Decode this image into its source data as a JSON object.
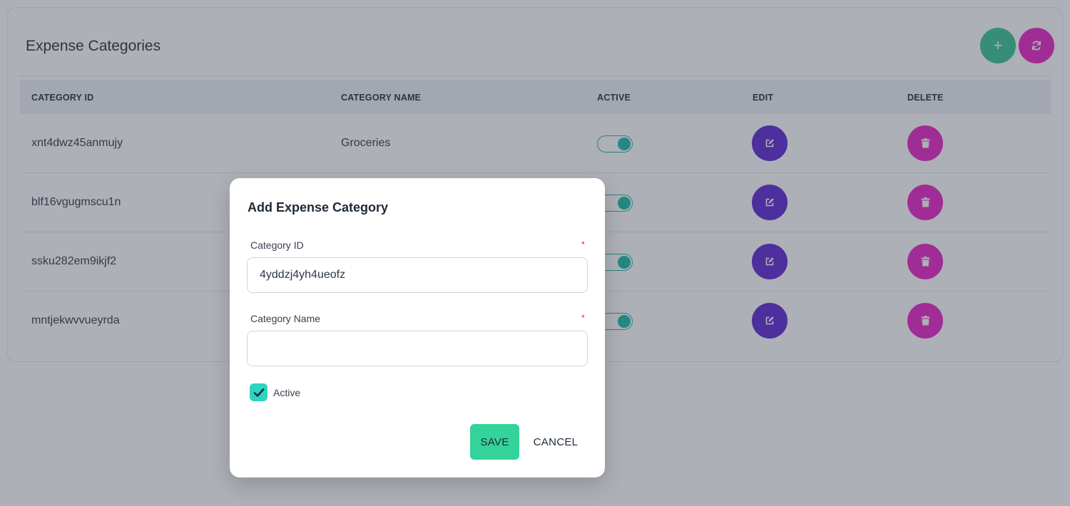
{
  "page": {
    "title": "Expense Categories"
  },
  "toolbar": {
    "add_icon": "plus-icon",
    "refresh_icon": "refresh-icon"
  },
  "table": {
    "columns": [
      "CATEGORY ID",
      "CATEGORY NAME",
      "ACTIVE",
      "EDIT",
      "DELETE"
    ],
    "rows": [
      {
        "id": "xnt4dwz45anmujy",
        "name": "Groceries",
        "active": true
      },
      {
        "id": "blf16vgugmscu1n",
        "name": "",
        "active": true
      },
      {
        "id": "ssku282em9ikjf2",
        "name": "",
        "active": true
      },
      {
        "id": "mntjekwvvueyrda",
        "name": "",
        "active": true
      }
    ]
  },
  "modal": {
    "title": "Add Expense Category",
    "category_id_label": "Category ID",
    "category_id_required": "*",
    "category_id_value": "4yddzj4yh4ueofz",
    "category_name_label": "Category Name",
    "category_name_required": "*",
    "category_name_value": "",
    "active_label": "Active",
    "active_checked": true,
    "save_label": "SAVE",
    "cancel_label": "CANCEL"
  },
  "colors": {
    "add": "#34c38f",
    "refresh": "#e91ec7",
    "edit": "#5b21d6",
    "delete": "#e91ec7",
    "toggle": "#14b8a6",
    "save": "#34d399"
  }
}
